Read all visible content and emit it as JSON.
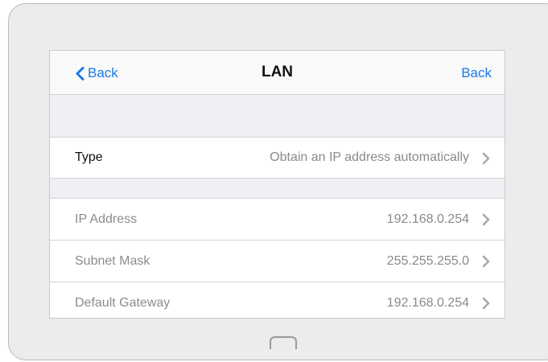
{
  "navbar": {
    "back_left_label": "Back",
    "title": "LAN",
    "back_right_label": "Back"
  },
  "rows": {
    "type": {
      "label": "Type",
      "value": "Obtain an IP address automatically"
    },
    "ip_address": {
      "label": "IP Address",
      "value": "192.168.0.254"
    },
    "subnet_mask": {
      "label": "Subnet Mask",
      "value": "255.255.255.0"
    },
    "default_gateway": {
      "label": "Default Gateway",
      "value": "192.168.0.254"
    }
  },
  "colors": {
    "accent": "#1a7ae6",
    "group_background": "#efeff4",
    "disabled_text": "#8c8c8c"
  },
  "icons": {
    "back": "chevron-left-icon",
    "row_arrow": "chevron-right-icon",
    "home": "home-button-icon"
  }
}
